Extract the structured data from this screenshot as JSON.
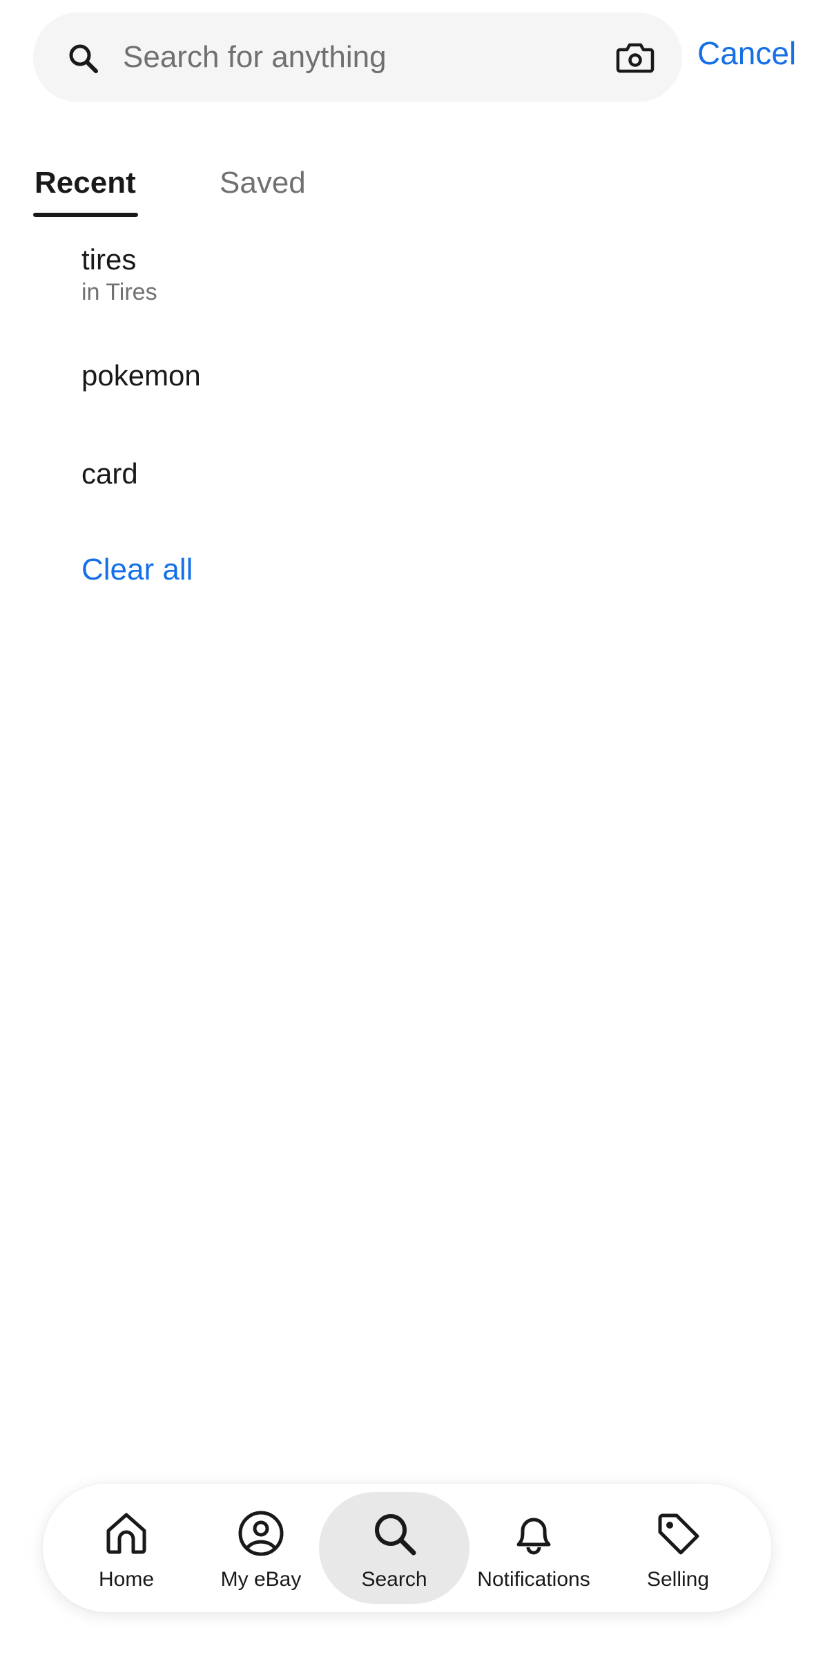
{
  "search": {
    "placeholder": "Search for anything",
    "value": "",
    "cancel_label": "Cancel"
  },
  "tabs": [
    {
      "label": "Recent",
      "active": true
    },
    {
      "label": "Saved",
      "active": false
    }
  ],
  "recent": [
    {
      "term": "tires",
      "category": "in Tires"
    },
    {
      "term": "pokemon",
      "category": ""
    },
    {
      "term": "card",
      "category": ""
    }
  ],
  "clear_all_label": "Clear all",
  "nav": [
    {
      "label": "Home",
      "icon": "home-icon"
    },
    {
      "label": "My eBay",
      "icon": "profile-icon"
    },
    {
      "label": "Search",
      "icon": "search-icon",
      "active": true
    },
    {
      "label": "Notifications",
      "icon": "bell-icon"
    },
    {
      "label": "Selling",
      "icon": "tag-icon"
    }
  ],
  "colors": {
    "accent": "#1570e8",
    "text": "#191919",
    "muted": "#707070",
    "search_bg": "#f4f5f4",
    "nav_active_bg": "#e8e8e8"
  }
}
